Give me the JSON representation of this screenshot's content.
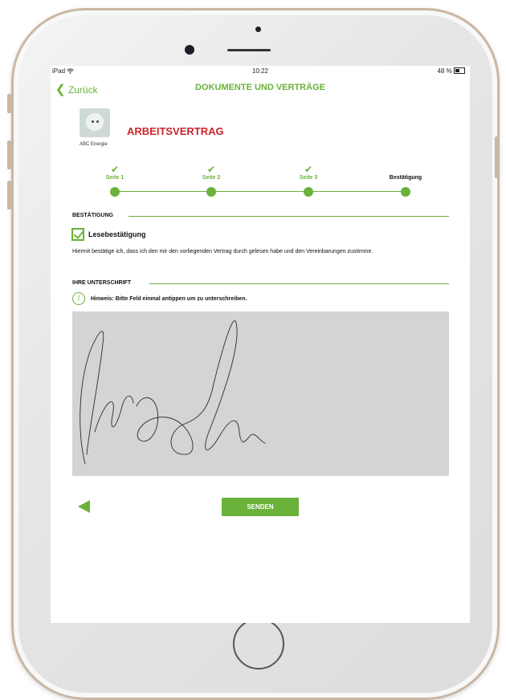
{
  "status_bar": {
    "device": "iPad",
    "wifi_icon": "wifi-icon",
    "time": "10:22",
    "battery": "48 %"
  },
  "nav": {
    "back_label": "Zurück",
    "title": "DOKUMENTE UND VERTRÄGE"
  },
  "document": {
    "logo_text": "ABC Energie",
    "title": "ARBEITSVERTRAG",
    "title_color": "#c8262b"
  },
  "steps": [
    {
      "label": "Seite 1",
      "completed": true
    },
    {
      "label": "Seite 2",
      "completed": true
    },
    {
      "label": "Seite 3",
      "completed": true
    },
    {
      "label": "Bestätigung",
      "completed": false,
      "current": true
    }
  ],
  "confirmation": {
    "section_title": "BESTÄTIGUNG",
    "checkbox_label": "Lesebestätigung",
    "checked": true,
    "text": "Hiermit bestätige ich, dass ich den mir den vorliegenden Vertrag durch gelesen habe und den Vereinbarungen zustimme."
  },
  "signature": {
    "section_title": "IHRE UNTERSCHRIFT",
    "hint": "Hinweis: Bitte Feld einmal antippen um zu unterschreiben."
  },
  "footer": {
    "prev_icon": "triangle-left-icon",
    "send_label": "SENDEN"
  },
  "colors": {
    "accent": "#6ab23a",
    "signature_bg": "#d4d4d4"
  }
}
